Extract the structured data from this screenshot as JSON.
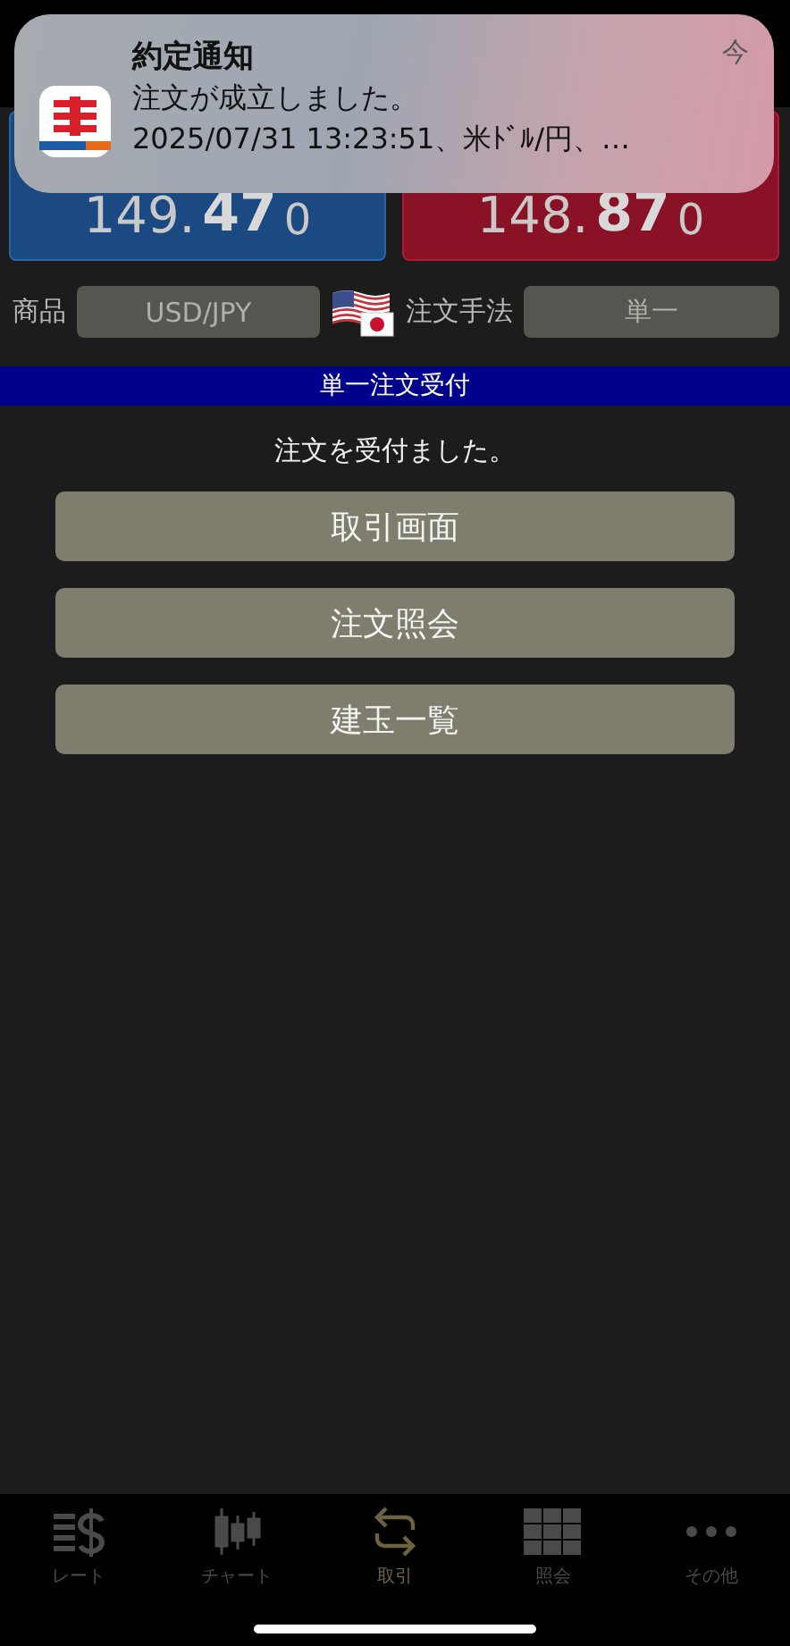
{
  "notification": {
    "title": "約定通知",
    "time": "今",
    "message": "注文が成立しました。",
    "detail": "2025/07/31 13:23:51、米ﾄﾞﾙ/円、…"
  },
  "prices": [
    {
      "kind": "bid",
      "prefix": "149.",
      "big": "47",
      "suffix": "0"
    },
    {
      "kind": "ask",
      "prefix": "148.",
      "big": "87",
      "suffix": "0"
    }
  ],
  "product": {
    "label": "商品",
    "value": "USD/JPY"
  },
  "order_method": {
    "label": "注文手法",
    "value": "単一"
  },
  "section_title": "単一注文受付",
  "message": "注文を受付ました。",
  "buttons": [
    "取引画面",
    "注文照会",
    "建玉一覧"
  ],
  "tabs": [
    {
      "label": "レート",
      "selected": false
    },
    {
      "label": "チャート",
      "selected": false
    },
    {
      "label": "取引",
      "selected": true
    },
    {
      "label": "照会",
      "selected": false
    },
    {
      "label": "その他",
      "selected": false
    }
  ]
}
